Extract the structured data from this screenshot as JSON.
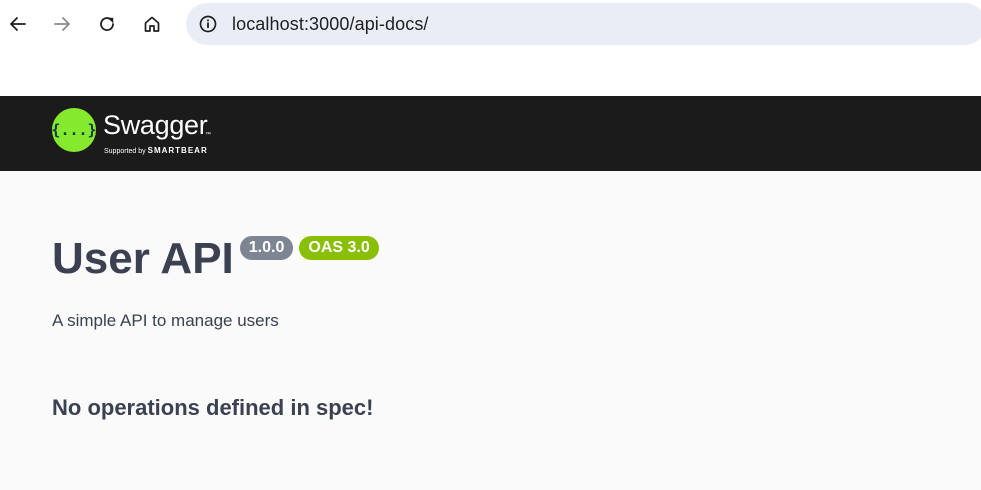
{
  "browser": {
    "url": "localhost:3000/api-docs/",
    "buttons": {
      "back": "back-arrow-icon",
      "forward": "forward-arrow-icon",
      "reload": "reload-icon",
      "home": "home-icon"
    }
  },
  "topbar": {
    "logo_title": "Swagger",
    "logo_tm": "™",
    "logo_sub_prefix": "Supported by",
    "logo_sub_brand": "SMARTBEAR",
    "logo_mark_text": "{...}",
    "colors": {
      "background": "#1b1b1b",
      "logo_mark": "#85ea2d"
    }
  },
  "info": {
    "title": "User API",
    "version_badge": "1.0.0",
    "oas_badge": "OAS 3.0",
    "description": "A simple API to manage users",
    "colors": {
      "version_badge": "#7d8492",
      "oas_badge": "#89bf04",
      "text": "#3b4151"
    }
  },
  "operations": {
    "empty_message": "No operations defined in spec!"
  }
}
